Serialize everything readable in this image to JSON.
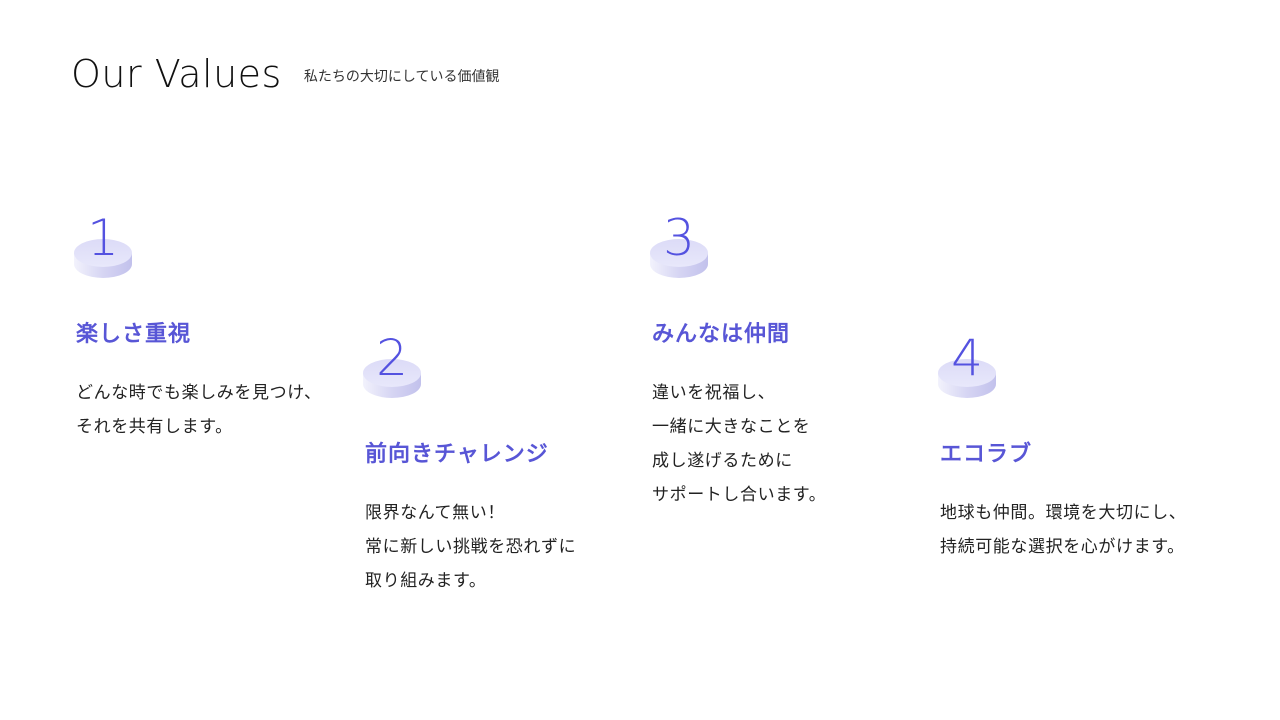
{
  "header": {
    "title": "Our Values",
    "subtitle": "私たちの大切にしている価値観"
  },
  "colors": {
    "accent": "#5856d6",
    "disc_light": "#e9e9fb",
    "disc_shade": "#c9c8ef"
  },
  "values": [
    {
      "number": "1",
      "title": "楽しさ重視",
      "lines": [
        "どんな時でも楽しみを見つけ、",
        "それを共有します。"
      ]
    },
    {
      "number": "2",
      "title": "前向きチャレンジ",
      "lines": [
        "限界なんて無い！",
        "常に新しい挑戦を恐れずに",
        "取り組みます。"
      ]
    },
    {
      "number": "3",
      "title": "みんなは仲間",
      "lines": [
        "違いを祝福し、",
        "一緒に大きなことを",
        "成し遂げるために",
        "サポートし合います。"
      ]
    },
    {
      "number": "4",
      "title": "エコラブ",
      "lines": [
        "地球も仲間。環境を大切にし、",
        "持続可能な選択を心がけます。"
      ]
    }
  ]
}
